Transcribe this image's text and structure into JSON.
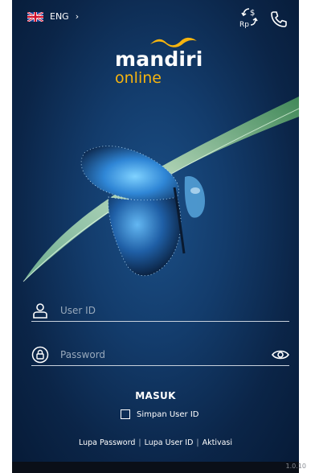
{
  "language": {
    "label": "ENG",
    "chevron": "›"
  },
  "icons": {
    "currency_exchange": "currency-exchange-icon",
    "phone": "phone-icon"
  },
  "brand": {
    "name": "mandiri",
    "sub": "online"
  },
  "login": {
    "user_placeholder": "User ID",
    "password_placeholder": "Password",
    "submit_label": "MASUK",
    "remember_label": "Simpan User ID"
  },
  "links": {
    "forgot_password": "Lupa Password",
    "forgot_user": "Lupa User ID",
    "activation": "Aktivasi",
    "separator": "|"
  },
  "version": "1.0.10",
  "colors": {
    "accent_yellow": "#f6b40f",
    "background": "#133c6c",
    "butterfly_blue": "#3a8fd9"
  }
}
